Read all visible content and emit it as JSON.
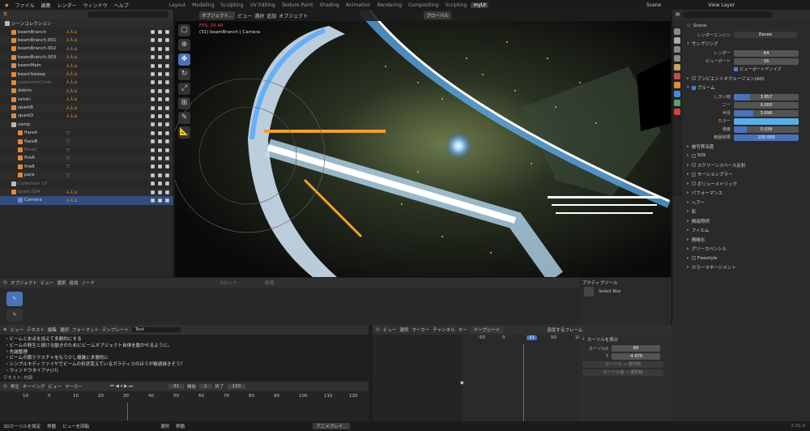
{
  "topmenu": {
    "items": [
      "ファイル",
      "編集",
      "レンダー",
      "ウィンドウ",
      "ヘルプ"
    ],
    "workspaces": [
      "Layout",
      "Modeling",
      "Sculpting",
      "UV Editing",
      "Texture Paint",
      "Shading",
      "Animation",
      "Rendering",
      "Compositing",
      "Scripting",
      "myUI"
    ],
    "active_workspace": "myUI",
    "scene": "Scene",
    "view_layer": "View Layer"
  },
  "outliner": {
    "root": "シーンコレクション",
    "rows": [
      {
        "label": "beamBranch",
        "type": "obj"
      },
      {
        "label": "beamBranch.001",
        "type": "obj"
      },
      {
        "label": "beamBranch.002",
        "type": "obj"
      },
      {
        "label": "beamBranch.003",
        "type": "obj"
      },
      {
        "label": "beamMain",
        "type": "obj"
      },
      {
        "label": "beamSweep",
        "type": "obj"
      },
      {
        "label": "explosionCircle",
        "type": "obj",
        "dim": true
      },
      {
        "label": "debris",
        "type": "obj"
      },
      {
        "label": "tatoki",
        "type": "obj"
      },
      {
        "label": "sparkB",
        "type": "obj"
      },
      {
        "label": "sparkD",
        "type": "obj"
      },
      {
        "label": "camp",
        "type": "coll"
      },
      {
        "label": "flareA",
        "type": "obj",
        "green": true
      },
      {
        "label": "flareB",
        "type": "obj",
        "green": true
      },
      {
        "label": "flareC",
        "type": "obj",
        "green": true,
        "dim": true
      },
      {
        "label": "fireA",
        "type": "obj",
        "green": true
      },
      {
        "label": "fireB",
        "type": "obj",
        "green": true
      },
      {
        "label": "para",
        "type": "obj",
        "green": true
      },
      {
        "label": "Collection 10",
        "type": "coll",
        "dim": true
      },
      {
        "label": "spark.004",
        "type": "obj",
        "dim": true
      },
      {
        "label": "Camera",
        "type": "cam",
        "selected": true
      }
    ]
  },
  "viewport": {
    "mode": "オブジェクト...",
    "menus": [
      "ビュー",
      "選択",
      "追加",
      "オブジェクト"
    ],
    "overlay": "グローバル",
    "fps": "FPS: 20.48",
    "info": "(31) beamBranch | Camera"
  },
  "properties": {
    "scene": "Scene",
    "render_engine_label": "レンダーエンジン",
    "render_engine": "Eevee",
    "sampling": "サンプリング",
    "render_label": "レンダー",
    "render_val": "64",
    "viewport_label": "ビューポート",
    "viewport_val": "16",
    "denoise": "ビューポートデノイズ",
    "ao": "アンビエントオクルージョン(AO)",
    "bloom": "ブルーム",
    "bloom_fields": [
      {
        "k": "しきい値",
        "v": "3.857",
        "fill": 0.25
      },
      {
        "k": "ニー",
        "v": "0.000",
        "fill": 0
      },
      {
        "k": "半径",
        "v": "3.696",
        "fill": 0.3
      },
      {
        "k": "カラー",
        "v": "",
        "fill": 1
      },
      {
        "k": "強度",
        "v": "0.038",
        "fill": 0.2
      },
      {
        "k": "範囲制限",
        "v": "100.000",
        "fill": 1
      }
    ],
    "sections": [
      "被写界深度",
      "SSS",
      "スクリーンスペース反射",
      "モーションブラー",
      "ボリューメトリック",
      "パフォーマンス",
      "ヘアー",
      "影",
      "間接照明",
      "フィルム",
      "簡略化",
      "グリースペンシル",
      "Freestyle",
      "カラーマネージメント"
    ]
  },
  "timeline": {
    "mode": "オブジェクト",
    "menus": [
      "ビュー",
      "選択",
      "追加",
      "ノード"
    ],
    "slot": "スロット",
    "action": "新規"
  },
  "tool_panel": {
    "title": "アクティブツール",
    "tool": "Select Box"
  },
  "text_editor": {
    "menus": [
      "ビュー",
      "テキスト",
      "編集",
      "選択",
      "フォーマット",
      "テンプレート"
    ],
    "file": "Text",
    "lines": [
      "・ビームと氷点を加えて多層的にする",
      "・ビームの発生と続ける動きのためにビームオブジェクト自体を動かせるように。",
      "・先端整理",
      "・ビームの節テクスチャをもう少し複雑に多層的に",
      "・シンプルモディファイヤでビームの形状変えているガラティスのほうが敏過描きそう？",
      "・ウィンドウタイアナ(パ)"
    ],
    "footer": "テキスト: 内部"
  },
  "dopesheet": {
    "menus": [
      "ビュー",
      "選択",
      "マーカー",
      "チャンネル",
      "キー"
    ],
    "mode": "ドープシート",
    "frame_label": "追従するフレーム",
    "ticks": [
      "-50",
      "0",
      "31",
      "50",
      "100"
    ],
    "current": "31",
    "cursor_title": "カーソルを表示",
    "cursor_x_label": "カーソルX",
    "cursor_x": "68",
    "cursor_y_label": "Y",
    "cursor_y": "-4.976",
    "btn1": "カーソル → 選択物",
    "btn2": "カーソル値 → 選択物"
  },
  "playback": {
    "menus": [
      "再生",
      "キーイング",
      "ビュー",
      "マーカー"
    ],
    "frame": "31",
    "start_label": "開始",
    "start": "1",
    "end_label": "終了",
    "end": "120",
    "ticks": [
      "10",
      "0",
      "10",
      "20",
      "30",
      "40",
      "50",
      "60",
      "70",
      "80",
      "90",
      "100",
      "110",
      "120"
    ]
  },
  "statusbar": {
    "items": [
      "3Dカーソルを設定",
      "移動",
      "ビューを回転",
      "選択",
      "移動",
      "アニメプレイ..."
    ],
    "version": "2.91.0"
  }
}
